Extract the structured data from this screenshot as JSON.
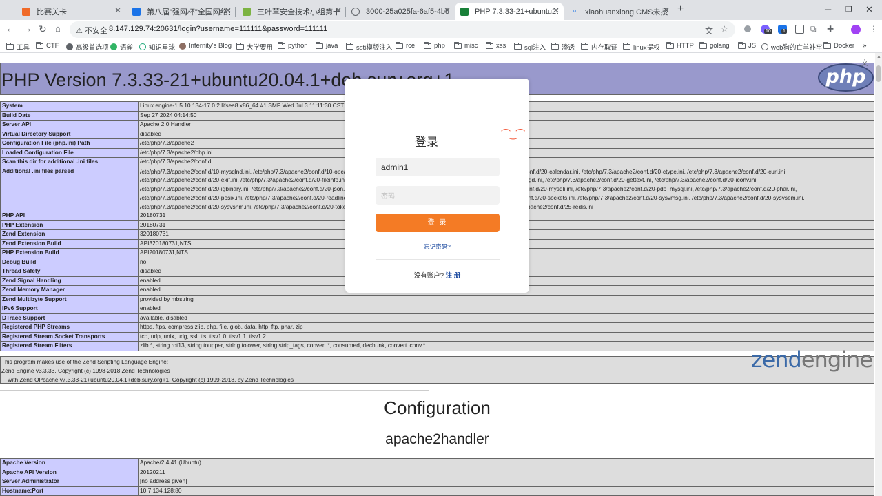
{
  "tabs": [
    {
      "title": "比赛关卡",
      "icon": "orange-shield-icon",
      "color": "#f06a28"
    },
    {
      "title": "第八届\"强网杯\"全国网络安全挑",
      "icon": "docs-icon",
      "color": "#1a73e8"
    },
    {
      "title": "三叶草安全技术小组第十五届",
      "icon": "leaf-icon",
      "color": "#7cb342"
    },
    {
      "title": "3000-25a025fa-6af5-4b59-bb",
      "icon": "globe-icon",
      "color": "#5f6368"
    },
    {
      "title": "PHP 7.3.33-21+ubuntu20.04.",
      "icon": "globe-icon",
      "color": "#188038"
    },
    {
      "title": "xiaohuanxiong CMS未授权访",
      "icon": "search-icon",
      "color": "#1a73e8"
    }
  ],
  "new_tab": "+",
  "address": {
    "security_label": "不安全",
    "url": "8.147.129.74:20631/login?username=111111&password=111111"
  },
  "bookmarks": [
    "工具",
    "CTF",
    "高级首选项",
    "语雀",
    "知识星球",
    "Infernity's Blog",
    "大学要用",
    "python",
    "java",
    "ssti模版注入",
    "rce",
    "php",
    "misc",
    "xss",
    "sql注入",
    "渗透",
    "内存取证",
    "linux提权",
    "HTTP",
    "golang",
    "JS",
    "web狗的亡羊补牢",
    "Docker"
  ],
  "phpinfo": {
    "title": "PHP Version 7.3.33-21+ubuntu20.04.1+deb.sury.org+1",
    "logo_text": "php",
    "rows": [
      {
        "key": "System",
        "value": "Linux engine-1 5.10.134-17.0.2.lifsea8.x86_64 #1 SMP Wed Jul 3 11:11:30 CST 2024 x86_64"
      },
      {
        "key": "Build Date",
        "value": "Sep 27 2024 04:14:50"
      },
      {
        "key": "Server API",
        "value": "Apache 2.0 Handler"
      },
      {
        "key": "Virtual Directory Support",
        "value": "disabled"
      },
      {
        "key": "Configuration File (php.ini) Path",
        "value": "/etc/php/7.3/apache2"
      },
      {
        "key": "Loaded Configuration File",
        "value": "/etc/php/7.3/apache2/php.ini"
      },
      {
        "key": "Scan this dir for additional .ini files",
        "value": "/etc/php/7.3/apache2/conf.d"
      },
      {
        "key": "Additional .ini files parsed",
        "lines": [
          "/etc/php/7.3/apache2/conf.d/10-mysqlnd.ini, /etc/php/7.3/apache2/conf.d/10-opcache.ini, /etc/php/7.3/apache2/conf.d/10-pdo.ini, /etc/php/7.3/apache2/conf.d/20-calendar.ini, /etc/php/7.3/apache2/conf.d/20-ctype.ini, /etc/php/7.3/apache2/conf.d/20-curl.ini,",
          "/etc/php/7.3/apache2/conf.d/20-exif.ini, /etc/php/7.3/apache2/conf.d/20-fileinfo.ini, /etc/php/7.3/apache2/conf.d/20-ftp.ini, /etc/php/7.3/apache2/conf.d/20-gd.ini, /etc/php/7.3/apache2/conf.d/20-gettext.ini, /etc/php/7.3/apache2/conf.d/20-iconv.ini,",
          "/etc/php/7.3/apache2/conf.d/20-igbinary.ini, /etc/php/7.3/apache2/conf.d/20-json.ini, /etc/php/7.3/apache2/conf.d/20-mbstring.ini, /etc/php/7.3/apache2/conf.d/20-mysqli.ini, /etc/php/7.3/apache2/conf.d/20-pdo_mysql.ini, /etc/php/7.3/apache2/conf.d/20-phar.ini,",
          "/etc/php/7.3/apache2/conf.d/20-posix.ini, /etc/php/7.3/apache2/conf.d/20-readline.ini, /etc/php/7.3/apache2/conf.d/20-shmop.ini, /etc/php/7.3/apache2/conf.d/20-sockets.ini, /etc/php/7.3/apache2/conf.d/20-sysvmsg.ini, /etc/php/7.3/apache2/conf.d/20-sysvsem.ini,",
          "/etc/php/7.3/apache2/conf.d/20-sysvshm.ini, /etc/php/7.3/apache2/conf.d/20-tokenizer.ini, /etc/php/7.3/apache2/conf.d/25-memcached.ini, /etc/php/7.3/apache2/conf.d/25-redis.ini"
        ]
      },
      {
        "key": "PHP API",
        "value": "20180731"
      },
      {
        "key": "PHP Extension",
        "value": "20180731"
      },
      {
        "key": "Zend Extension",
        "value": "320180731"
      },
      {
        "key": "Zend Extension Build",
        "value": "API320180731,NTS"
      },
      {
        "key": "PHP Extension Build",
        "value": "API20180731,NTS"
      },
      {
        "key": "Debug Build",
        "value": "no"
      },
      {
        "key": "Thread Safety",
        "value": "disabled"
      },
      {
        "key": "Zend Signal Handling",
        "value": "enabled"
      },
      {
        "key": "Zend Memory Manager",
        "value": "enabled"
      },
      {
        "key": "Zend Multibyte Support",
        "value": "provided by mbstring"
      },
      {
        "key": "IPv6 Support",
        "value": "enabled"
      },
      {
        "key": "DTrace Support",
        "value": "available, disabled"
      },
      {
        "key": "Registered PHP Streams",
        "value": "https, ftps, compress.zlib, php, file, glob, data, http, ftp, phar, zip"
      },
      {
        "key": "Registered Stream Socket Transports",
        "value": "tcp, udp, unix, udg, ssl, tls, tlsv1.0, tlsv1.1, tlsv1.2"
      },
      {
        "key": "Registered Stream Filters",
        "value": "zlib.*, string.rot13, string.toupper, string.tolower, string.strip_tags, convert.*, consumed, dechunk, convert.iconv.*"
      }
    ],
    "zend": {
      "line1": "This program makes use of the Zend Scripting Language Engine:",
      "line2": "Zend Engine v3.3.33, Copyright (c) 1998-2018 Zend Technologies",
      "line3": "    with Zend OPcache v7.3.33-21+ubuntu20.04.1+deb.sury.org+1, Copyright (c) 1999-2018, by Zend Technologies",
      "logo_a": "zend",
      "logo_b": "engine"
    },
    "config_heading": "Configuration",
    "apache_heading": "apache2handler",
    "apache_rows": [
      {
        "key": "Apache Version",
        "value": "Apache/2.4.41 (Ubuntu)"
      },
      {
        "key": "Apache API Version",
        "value": "20120211"
      },
      {
        "key": "Server Administrator",
        "value": "[no address given]"
      },
      {
        "key": "Hostname:Port",
        "value": "10.7.134.128:80"
      }
    ]
  },
  "login": {
    "title": "登录",
    "username_value": "admin1",
    "password_placeholder": "密码",
    "submit_label": "登 录",
    "forgot_label": "忘记密码?",
    "no_account_label": "没有账户?",
    "signup_label": "注 册"
  },
  "extension_badges": [
    "10",
    "1"
  ]
}
